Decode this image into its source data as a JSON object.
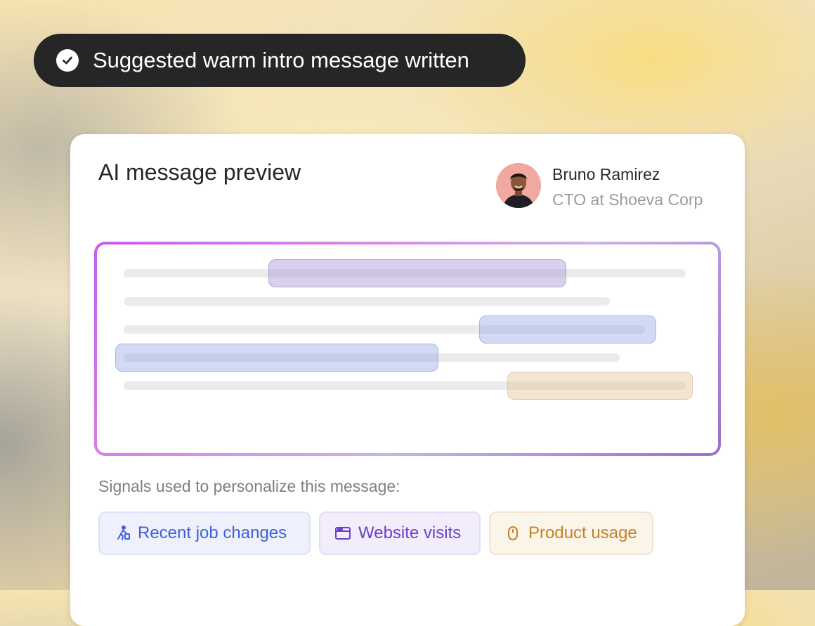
{
  "toast": {
    "message": "Suggested warm intro message written"
  },
  "card": {
    "title": "AI message preview",
    "contact": {
      "name": "Bruno Ramirez",
      "role": "CTO at Shoeva Corp"
    },
    "signals_label": "Signals used to personalize this message:",
    "signals": [
      {
        "label": "Recent job changes",
        "icon": "person-walking-icon",
        "color": "#3e5fdc"
      },
      {
        "label": "Website visits",
        "icon": "browser-window-icon",
        "color": "#6d3fc8"
      },
      {
        "label": "Product usage",
        "icon": "mouse-icon",
        "color": "#c38326"
      }
    ]
  },
  "colors": {
    "toast_bg": "#262626",
    "highlight_purple": "#aa96d7",
    "highlight_blue": "#8ca0e6",
    "highlight_orange": "#e1be8c",
    "frame_gradient": [
      "#c95bf0",
      "#9b6fc9"
    ]
  }
}
